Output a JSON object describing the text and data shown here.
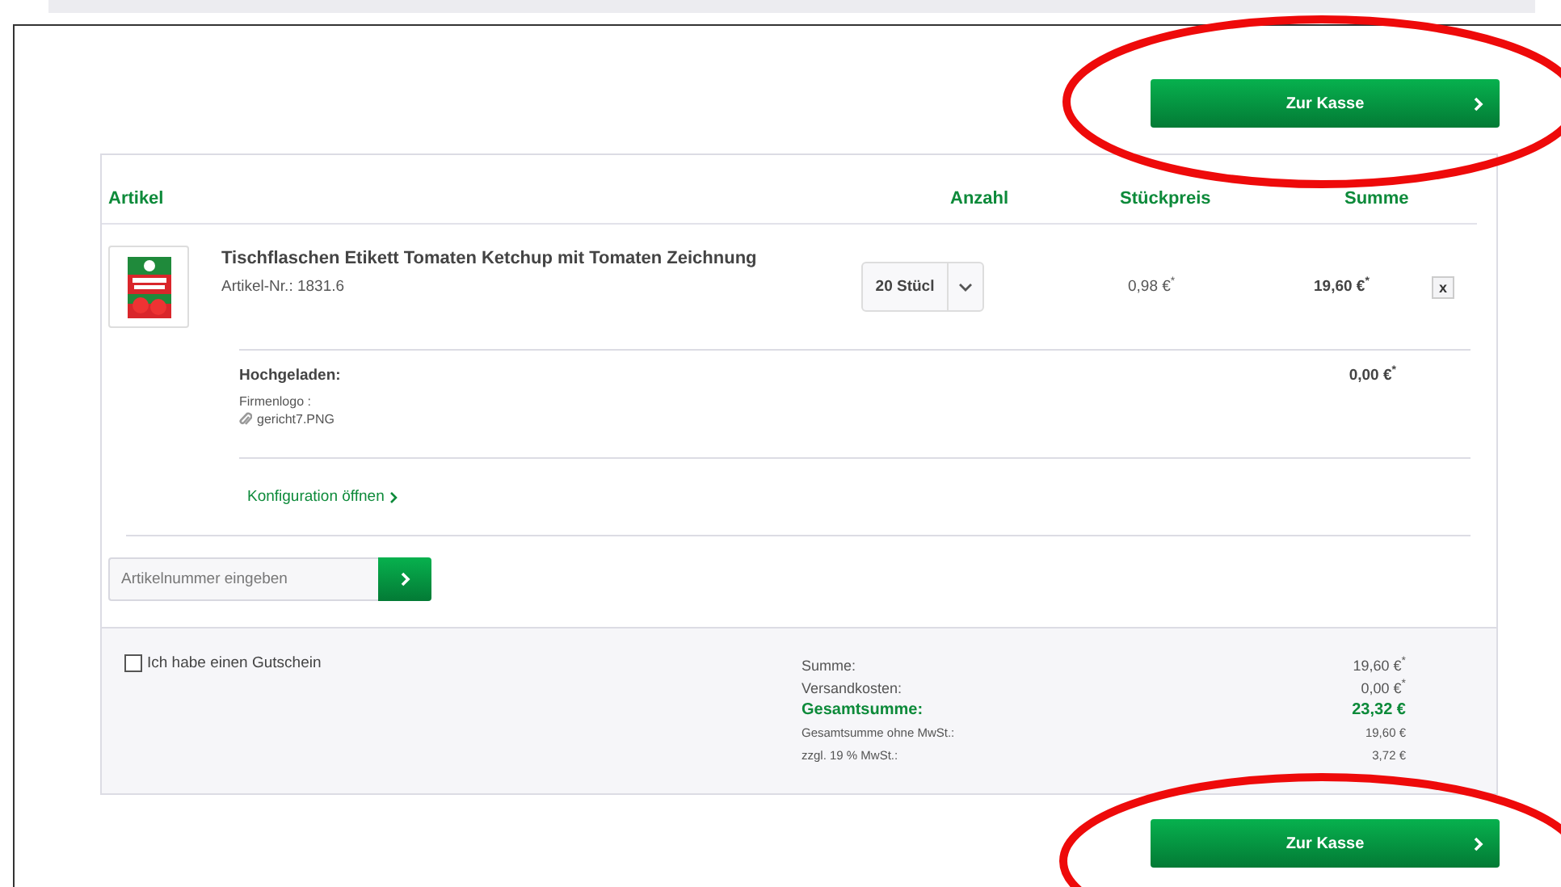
{
  "top_button": {
    "label": "Zur Kasse"
  },
  "cart": {
    "columns": [
      {
        "label": "Artikel"
      },
      {
        "label": "Anzahl"
      },
      {
        "label": "Stückpreis"
      },
      {
        "label": "Summe"
      }
    ],
    "items": [
      {
        "title": "Tischflaschen Etikett Tomaten Ketchup mit Tomaten Zeichnung",
        "article_no": "Artikel-Nr.: 1831.6",
        "quantity": "20 Stücl",
        "unit_price": "0,98 €$^{*}$",
        "sum": "19,60 €$^{*}$",
        "remove": "x",
        "upload": {
          "heading": "Hochgeladen:",
          "field": "Firmenlogo :",
          "file": "gericht7.PNG",
          "price": "0,00 €$^{*}$"
        },
        "config_link": "Konfiguration öffnen"
      }
    ]
  },
  "article_input": {
    "placeholder": "Artikelnummer eingeben"
  },
  "voucher": {
    "label": "Ich habe einen Gutschein",
    "checked": false
  },
  "totals": [
    {
      "kind": "normal",
      "label": "Summe:",
      "value": "19,60 €$^{*}$"
    },
    {
      "kind": "normal",
      "label": "Versandkosten:",
      "value": "0,00 €$^{*}$"
    },
    {
      "kind": "grand",
      "label": "Gesamtsumme:",
      "value": "23,32 €"
    },
    {
      "kind": "small",
      "label": "Gesamtsumme ohne MwSt.:",
      "value": "19,60 €"
    },
    {
      "kind": "small",
      "label": "zzgl. 19 % MwSt.:",
      "value": "3,72 €"
    }
  ],
  "bottom_button": {
    "label": "Zur Kasse"
  }
}
